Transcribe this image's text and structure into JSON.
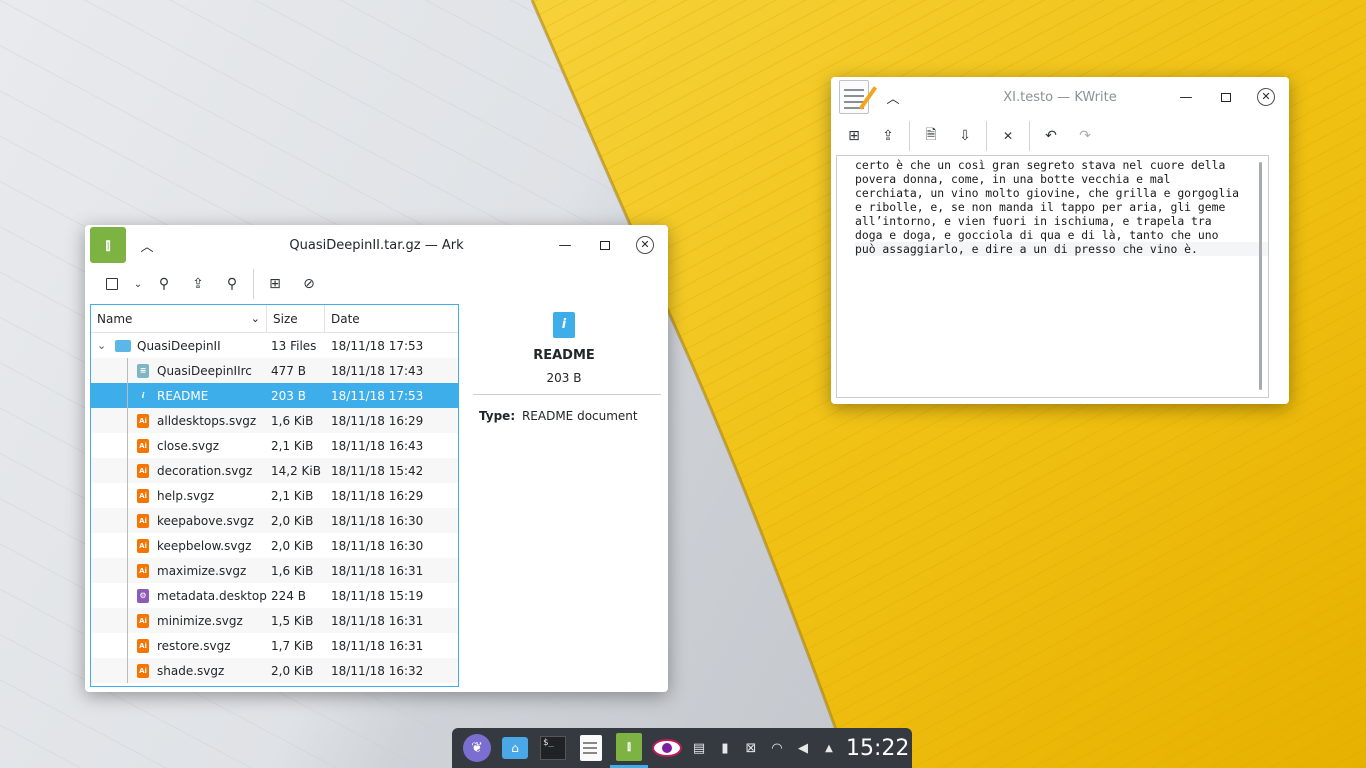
{
  "ark": {
    "title": "QuasiDeepinII.tar.gz — Ark",
    "columns": [
      "Name",
      "Size",
      "Date"
    ],
    "root": {
      "name": "QuasiDeepinII",
      "size": "13 Files",
      "date": "18/11/18 17:53"
    },
    "files": [
      {
        "name": "QuasiDeepinIIrc",
        "size": "477 B",
        "date": "18/11/18 17:43",
        "icon": "rc"
      },
      {
        "name": "README",
        "size": "203 B",
        "date": "18/11/18 17:53",
        "icon": "info",
        "selected": true
      },
      {
        "name": "alldesktops.svgz",
        "size": "1,6 KiB",
        "date": "18/11/18 16:29",
        "icon": "svg"
      },
      {
        "name": "close.svgz",
        "size": "2,1 KiB",
        "date": "18/11/18 16:43",
        "icon": "svg"
      },
      {
        "name": "decoration.svgz",
        "size": "14,2 KiB",
        "date": "18/11/18 15:42",
        "icon": "svg"
      },
      {
        "name": "help.svgz",
        "size": "2,1 KiB",
        "date": "18/11/18 16:29",
        "icon": "svg"
      },
      {
        "name": "keepabove.svgz",
        "size": "2,0 KiB",
        "date": "18/11/18 16:30",
        "icon": "svg"
      },
      {
        "name": "keepbelow.svgz",
        "size": "2,0 KiB",
        "date": "18/11/18 16:30",
        "icon": "svg"
      },
      {
        "name": "maximize.svgz",
        "size": "1,6 KiB",
        "date": "18/11/18 16:31",
        "icon": "svg"
      },
      {
        "name": "metadata.desktop",
        "size": "224 B",
        "date": "18/11/18 15:19",
        "icon": "desktop"
      },
      {
        "name": "minimize.svgz",
        "size": "1,5 KiB",
        "date": "18/11/18 16:31",
        "icon": "svg"
      },
      {
        "name": "restore.svgz",
        "size": "1,7 KiB",
        "date": "18/11/18 16:31",
        "icon": "svg"
      },
      {
        "name": "shade.svgz",
        "size": "2,0 KiB",
        "date": "18/11/18 16:32",
        "icon": "svg"
      }
    ],
    "details": {
      "name": "README",
      "size": "203 B",
      "type_label": "Type:",
      "type_value": "README document"
    }
  },
  "kwrite": {
    "title": "XI.testo — KWrite",
    "lines": [
      "certo è che un così gran segreto stava nel cuore della",
      "povera donna, come, in una botte vecchia e mal",
      "cerchiata, un vino molto giovine, che grilla e gorgoglia",
      "e ribolle, e, se non manda il tappo per aria, gli geme",
      "all’intorno, e vien fuori in ischiuma, e trapela tra",
      "doga e doga, e gocciola di qua e di là, tanto che uno",
      "può assaggiarlo, e dire a un di presso che vino è."
    ]
  },
  "taskbar": {
    "clock": "15:22",
    "apps": [
      "launcher-icon",
      "file-manager-icon",
      "terminal-icon",
      "text-editor-icon",
      "archive-manager-icon",
      "eye-of-gnome-icon"
    ]
  },
  "colors": {
    "accent": "#3daee9",
    "taskbar": "#343a40",
    "wallpaper_yellow": "#f2c418"
  }
}
